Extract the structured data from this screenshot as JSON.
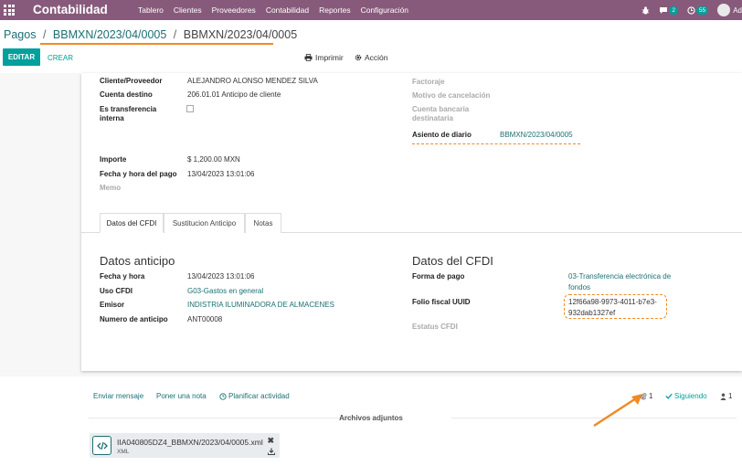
{
  "topbar": {
    "brand": "Contabilidad",
    "menu": [
      "Tablero",
      "Clientes",
      "Proveedores",
      "Contabilidad",
      "Reportes",
      "Configuración"
    ],
    "messages_count": "2",
    "activities_count": "55",
    "user_initial": "Ad"
  },
  "breadcrumb": {
    "root": "Pagos",
    "sep": "/",
    "record": "BBMXN/2023/04/0005",
    "current": "BBMXN/2023/04/0005"
  },
  "controls": {
    "edit": "EDITAR",
    "create": "CREAR",
    "print": "Imprimir",
    "action": "Acción"
  },
  "form": {
    "left": [
      {
        "label": "Cliente/Proveedor",
        "value": "ALEJANDRO ALONSO MENDEZ SILVA"
      },
      {
        "label": "Cuenta destino",
        "value": "206.01.01 Anticipo de cliente"
      },
      {
        "label": "Es transferencia interna",
        "value": ""
      },
      {
        "label": "Importe",
        "value": "$ 1,200.00  MXN"
      },
      {
        "label": "Fecha y hora del pago",
        "value": "13/04/2023 13:01:06"
      },
      {
        "label": "Memo",
        "value": ""
      }
    ],
    "right": {
      "factoraje": "Factoraje",
      "motivo": "Motivo de cancelación",
      "cuenta_bancaria": "Cuenta bancaria destinataria",
      "asiento_label": "Asiento de diario",
      "asiento_value": "BBMXN/2023/04/0005"
    }
  },
  "tabs": [
    "Datos del CFDI",
    "Sustitucion Anticipo",
    "Notas"
  ],
  "anticipo": {
    "title": "Datos anticipo",
    "rows": [
      {
        "label": "Fecha y hora",
        "value": "13/04/2023 13:01:06"
      },
      {
        "label": "Uso CFDI",
        "value": "G03-Gastos en general"
      },
      {
        "label": "Emisor",
        "value": "INDISTRIA ILUMINADORA DE ALMACENES"
      },
      {
        "label": "Numero de anticipo",
        "value": "ANT00008"
      }
    ]
  },
  "cfdi": {
    "title": "Datos del CFDI",
    "forma_label": "Forma de pago",
    "forma_line1": "03-Transferencia electrónica de",
    "forma_line2": "fondos",
    "folio_label": "Folio fiscal UUID",
    "folio_line1": "12f66a98-9973-4011-b7e3-",
    "folio_line2": "932dab1327ef",
    "estatus_label": "Estatus CFDI"
  },
  "chatter": {
    "send": "Enviar mensaje",
    "note": "Poner una nota",
    "plan": "Planificar actividad",
    "attach_count": "1",
    "following": "Siguiendo",
    "followers": "1",
    "attachments_title": "Archivos adjuntos",
    "file_name": "IIA040805DZ4_BBMXN/2023/04/0005.xml",
    "file_type": "XML"
  },
  "colors": {
    "brand": "#875a7b",
    "accent": "#00a09d",
    "link": "#1d6f73",
    "highlight": "#f08a24"
  }
}
